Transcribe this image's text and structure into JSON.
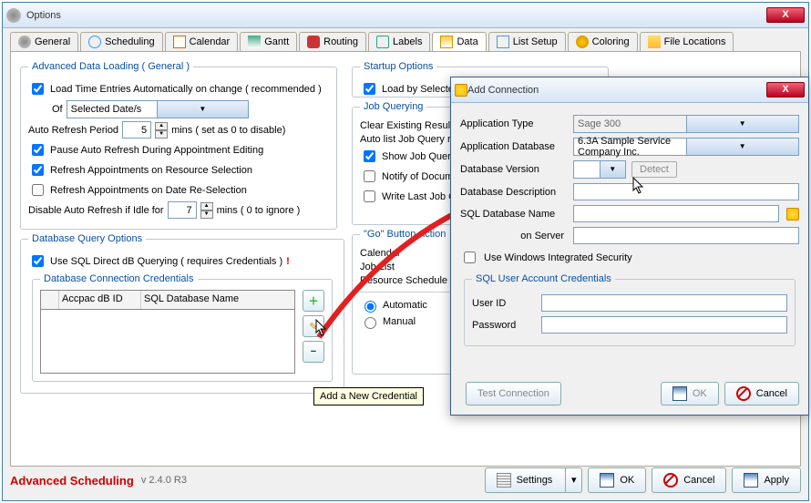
{
  "options_window": {
    "title": "Options",
    "close_x": "X",
    "tabs": [
      "General",
      "Scheduling",
      "Calendar",
      "Gantt",
      "Routing",
      "Labels",
      "Data",
      "List Setup",
      "Coloring",
      "File Locations"
    ],
    "active_tab": "Data"
  },
  "advanced_data_loading": {
    "legend": "Advanced Data Loading ( General )",
    "load_time_entries_label": "Load Time Entries Automatically on change ( recommended )",
    "load_time_entries_checked": true,
    "of_label": "Of",
    "of_value": "Selected Date/s",
    "auto_refresh_label_left": "Auto Refresh Period",
    "auto_refresh_value": "5",
    "auto_refresh_label_right": "mins ( set as 0 to disable)",
    "pause_label": "Pause Auto Refresh During Appointment Editing",
    "pause_checked": true,
    "refresh_resource_label": "Refresh Appointments on Resource Selection",
    "refresh_resource_checked": true,
    "refresh_date_label": "Refresh Appointments on Date Re-Selection",
    "refresh_date_checked": false,
    "disable_idle_left": "Disable Auto Refresh if Idle for",
    "disable_idle_value": "7",
    "disable_idle_right": "mins ( 0 to ignore )"
  },
  "db_query_options": {
    "legend": "Database Query Options",
    "use_sql_label": "Use SQL Direct dB Querying ( requires Credentials )",
    "use_sql_checked": true,
    "warn": "!",
    "credentials_legend": "Database Connection Credentials",
    "col_accpac": "Accpac dB ID",
    "col_sql": "SQL Database Name",
    "add_tooltip": "Add a New Credential"
  },
  "startup_options": {
    "legend": "Startup Options",
    "load_by_selected_label": "Load by Selected D",
    "load_by_selected_checked": true
  },
  "job_querying": {
    "legend": "Job Querying",
    "clear_label": "Clear Existing Results B",
    "autolist_label": "Auto list Job Query res",
    "show_label": "Show Job Query N",
    "show_checked": true,
    "notify_label": "Notify of Documen",
    "notify_checked": false,
    "write_label": "Write Last Job Qu",
    "write_checked": false
  },
  "go_button": {
    "legend": "\"Go\" Button Action",
    "chev": "»",
    "calendar": "Calendar",
    "joblist": "Job List",
    "resource": "Resource Schedule",
    "automatic": "Automatic",
    "automatic_selected": true,
    "manual": "Manual",
    "manual_selected": false
  },
  "footer": {
    "product": "Advanced Scheduling",
    "version": "v 2.4.0 R3",
    "settings": "Settings",
    "ok": "OK",
    "cancel": "Cancel",
    "apply": "Apply"
  },
  "add_connection": {
    "title": "Add Connection",
    "close_x": "X",
    "app_type_label": "Application Type",
    "app_type_value": "Sage 300",
    "app_db_label": "Application Database",
    "app_db_value": "6.3A Sample Service Company Inc.",
    "db_version_label": "Database Version",
    "db_version_value": "",
    "detect_label": "Detect",
    "db_desc_label": "Database Description",
    "db_desc_value": "",
    "sql_name_label": "SQL Database Name",
    "sql_name_value": "",
    "on_server_label": "on Server",
    "on_server_value": "",
    "win_integrated_label": "Use Windows Integrated Security",
    "win_integrated_checked": false,
    "sql_creds_legend": "SQL User Account Credentials",
    "user_label": "User ID",
    "user_value": "",
    "pass_label": "Password",
    "pass_value": "",
    "test_label": "Test Connection",
    "ok": "OK",
    "cancel": "Cancel"
  }
}
